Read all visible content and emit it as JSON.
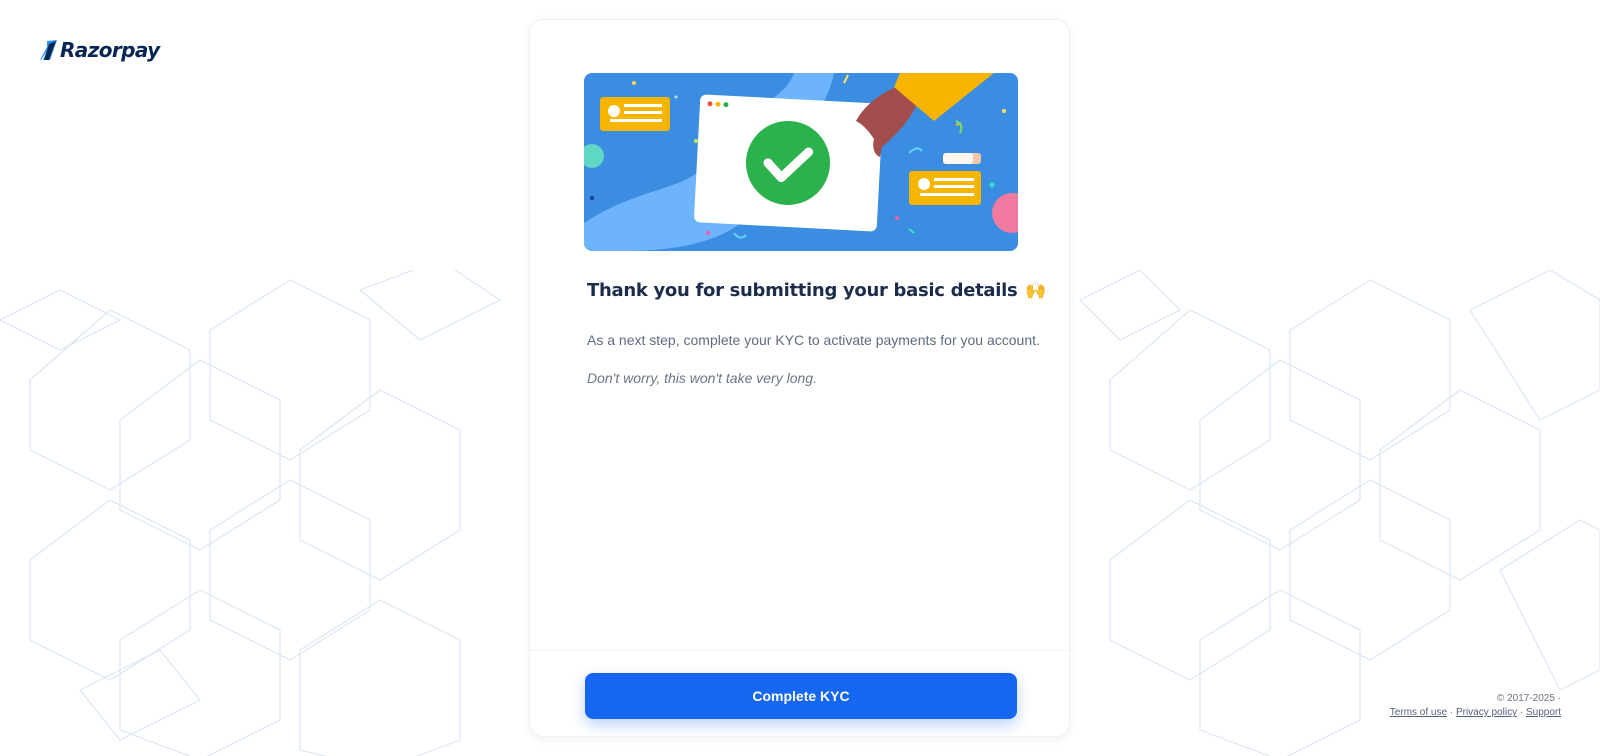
{
  "brand": {
    "name": "Razorpay",
    "color": "#072654",
    "mark_color": "#3395ff"
  },
  "icons": {
    "celebration": "🙌",
    "checkmark": "check-circle-icon"
  },
  "card": {
    "title": "Thank you for submitting your basic details",
    "subtitle": "As a next step, complete your KYC to activate payments for you account.",
    "note": "Don't worry, this won't take very long.",
    "cta_label": "Complete KYC"
  },
  "footer": {
    "copyright": "© 2017-2025 ·",
    "links": [
      "Terms of use",
      "Privacy policy",
      "Support"
    ],
    "separator": " · "
  },
  "colors": {
    "primary": "#1566f0",
    "success": "#2bb24c",
    "accent": "#f7b500"
  }
}
